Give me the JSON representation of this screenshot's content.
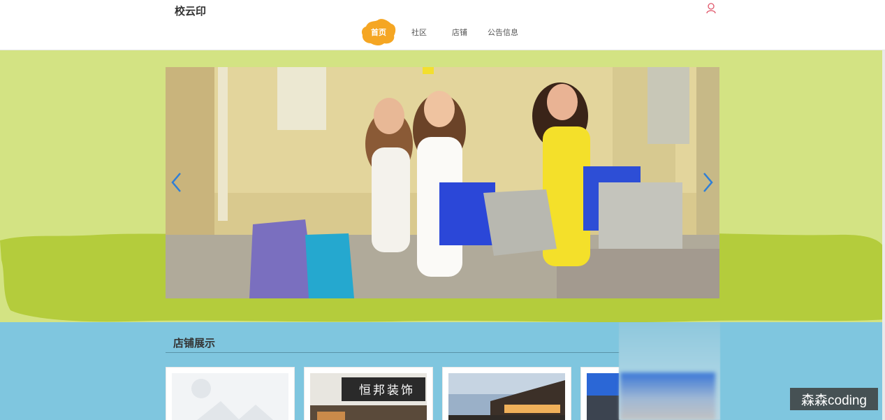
{
  "header": {
    "logo": "校云印",
    "nav": {
      "home": "首页",
      "community": "社区",
      "shop": "店铺",
      "notice": "公告信息"
    }
  },
  "banner": {
    "prev_icon": "chevron-left-icon",
    "next_icon": "chevron-right-icon"
  },
  "shops": {
    "title": "店铺展示",
    "cards": [
      {
        "name": "placeholder-image"
      },
      {
        "name": "shop-image-1",
        "sign_text": "恒邦装饰"
      },
      {
        "name": "shop-image-2"
      },
      {
        "name": "shop-image-3"
      }
    ]
  },
  "watermark": "森森coding",
  "colors": {
    "accent": "#f5a623",
    "banner_bg": "#d3e383",
    "banner_blob": "#b4cc3c",
    "section_bg": "#7fc6df",
    "arrow": "#2f7fd6"
  }
}
